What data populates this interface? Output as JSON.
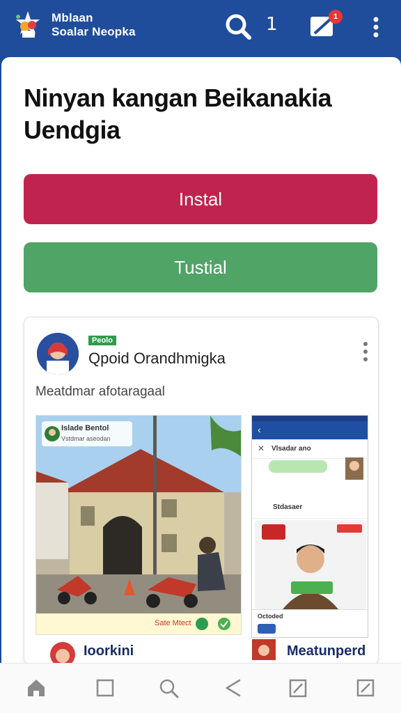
{
  "header": {
    "brand_line1": "Mblaan",
    "brand_line2": "Soalar Neopka",
    "notification_count": "1",
    "message_badge": "1",
    "icons": [
      "logo-icon",
      "search-icon",
      "message-icon",
      "more-vert-icon"
    ]
  },
  "main": {
    "title": "Ninyan kangan Beikanakia Uendgia",
    "install_button": "Instal",
    "test_button": "Tustial"
  },
  "post": {
    "tag": "Peolo",
    "author": "Qpoid Orandhmigka",
    "text": "Meatdmar afotaragaal",
    "photo_caption_title": "Islade Bentol",
    "photo_caption_sub": "Vstdmar aseodan",
    "photo_bar_text": "Sate Mtect",
    "phone_labels": [
      "Vlsadar ano",
      "Stdasaer",
      "Octoded"
    ]
  },
  "next_row": {
    "left_text": "Ioorkini",
    "right_text": "Meatunperd"
  },
  "bottom_nav": {
    "items": [
      "home-icon",
      "square-icon",
      "search-icon",
      "share-icon",
      "edit-icon",
      "expand-icon"
    ]
  },
  "colors": {
    "header": "#1f4d9c",
    "install": "#c0244e",
    "test": "#4fa466"
  }
}
